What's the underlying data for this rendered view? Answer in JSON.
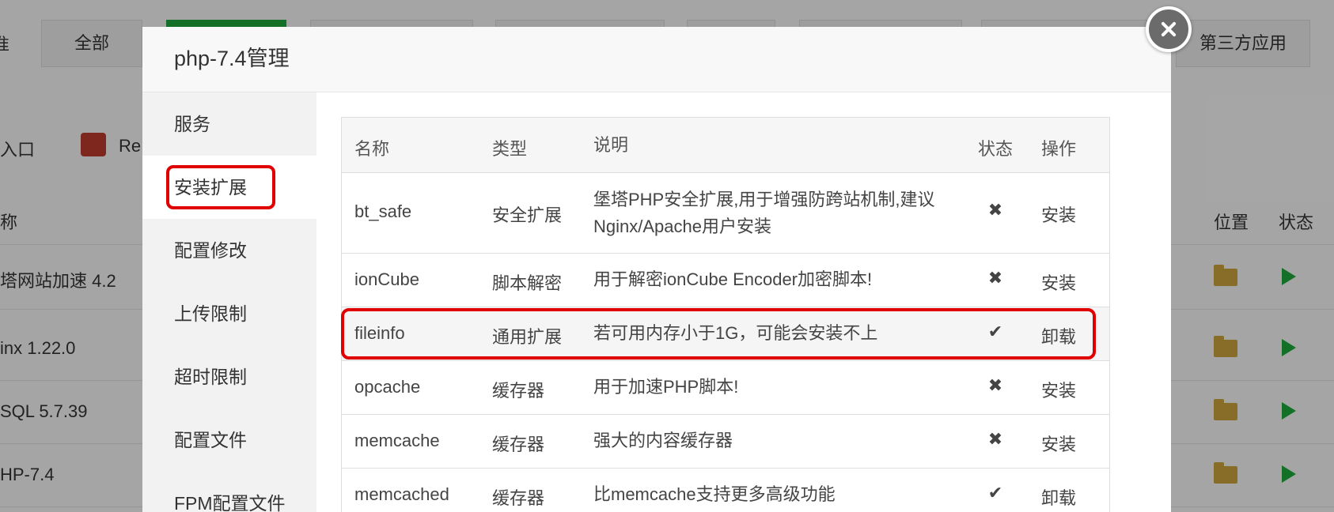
{
  "background": {
    "tabs": [
      "全部",
      "第三方应用"
    ],
    "left_fragment": "准",
    "toolbar": {
      "entry": "入口",
      "redis": "Re"
    },
    "table_header": {
      "left": "称",
      "position": "位置",
      "status": "状态"
    },
    "rows": [
      "塔网站加速 4.2",
      "inx 1.22.0",
      "SQL 5.7.39",
      "HP-7.4"
    ]
  },
  "modal": {
    "title": "php-7.4管理",
    "close_icon": "close-icon",
    "sidebar": [
      {
        "label": "服务",
        "active": false
      },
      {
        "label": "安装扩展",
        "active": true
      },
      {
        "label": "配置修改",
        "active": false
      },
      {
        "label": "上传限制",
        "active": false
      },
      {
        "label": "超时限制",
        "active": false
      },
      {
        "label": "配置文件",
        "active": false
      },
      {
        "label": "FPM配置文件",
        "active": false
      }
    ],
    "table": {
      "headers": {
        "name": "名称",
        "type": "类型",
        "desc": "说明",
        "status": "状态",
        "op": "操作"
      },
      "rows": [
        {
          "name": "bt_safe",
          "type": "安全扩展",
          "desc": "堡塔PHP安全扩展,用于增强防跨站机制,建议Nginx/Apache用户安装",
          "status": "✖",
          "op": "安装",
          "installed": false
        },
        {
          "name": "ionCube",
          "type": "脚本解密",
          "desc": "用于解密ionCube Encoder加密脚本!",
          "status": "✖",
          "op": "安装",
          "installed": false
        },
        {
          "name": "fileinfo",
          "type": "通用扩展",
          "desc": "若可用内存小于1G，可能会安装不上",
          "status": "✔",
          "op": "卸载",
          "installed": true
        },
        {
          "name": "opcache",
          "type": "缓存器",
          "desc": "用于加速PHP脚本!",
          "status": "✖",
          "op": "安装",
          "installed": false
        },
        {
          "name": "memcache",
          "type": "缓存器",
          "desc": "强大的内容缓存器",
          "status": "✖",
          "op": "安装",
          "installed": false
        },
        {
          "name": "memcached",
          "type": "缓存器",
          "desc": "比memcache支持更多高级功能",
          "status": "✔",
          "op": "卸载",
          "installed": true
        }
      ]
    }
  },
  "colors": {
    "accent_green": "#20a53a",
    "danger_red": "#e00000",
    "highlight_red": "#e00000"
  }
}
